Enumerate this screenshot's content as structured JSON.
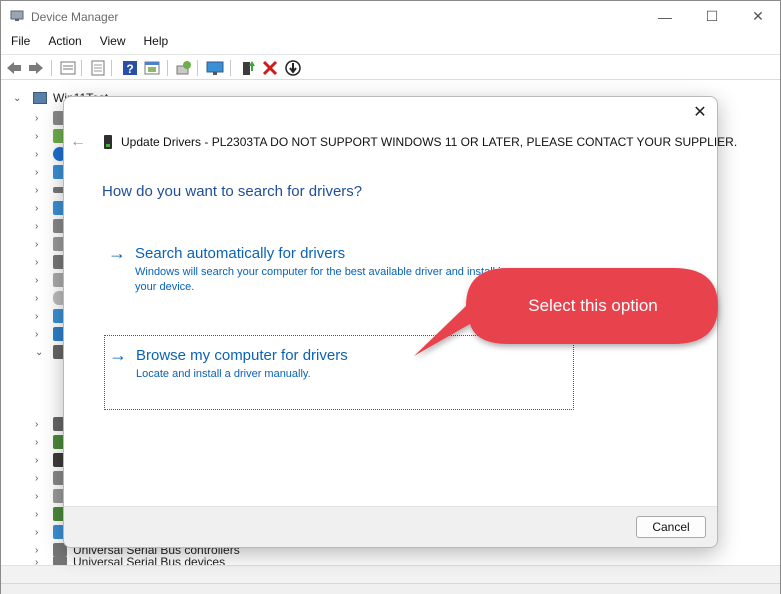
{
  "window": {
    "title": "Device Manager",
    "minimize_glyph": "—",
    "maximize_glyph": "☐",
    "close_glyph": "✕"
  },
  "menu": {
    "items": [
      "File",
      "Action",
      "View",
      "Help"
    ]
  },
  "toolbar": {
    "icons": [
      "back-icon",
      "forward-icon",
      "properties-icon",
      "computer-view-icon",
      "help-icon",
      "action-view-icon",
      "scan-hardware-icon",
      "monitor-icon",
      "update-driver-icon",
      "uninstall-icon",
      "disable-icon"
    ]
  },
  "tree": {
    "root_label": "Win11Test",
    "visible_labels": [
      "Universal Serial Bus controllers",
      "Universal Serial Bus devices"
    ]
  },
  "dialog": {
    "close_glyph": "✕",
    "back_glyph": "←",
    "title": "Update Drivers - PL2303TA DO NOT SUPPORT WINDOWS 11 OR LATER, PLEASE CONTACT YOUR SUPPLIER.",
    "heading": "How do you want to search for drivers?",
    "options": [
      {
        "arrow": "→",
        "title": "Search automatically for drivers",
        "description": "Windows will search your computer for the best available driver and install it on your device."
      },
      {
        "arrow": "→",
        "title": "Browse my computer for drivers",
        "description": "Locate and install a driver manually."
      }
    ],
    "cancel_label": "Cancel"
  },
  "annotation": {
    "text": "Select this option",
    "color": "#e8434e"
  },
  "colors": {
    "link_blue": "#0a62b6",
    "heading_blue": "#1f4e9a"
  }
}
